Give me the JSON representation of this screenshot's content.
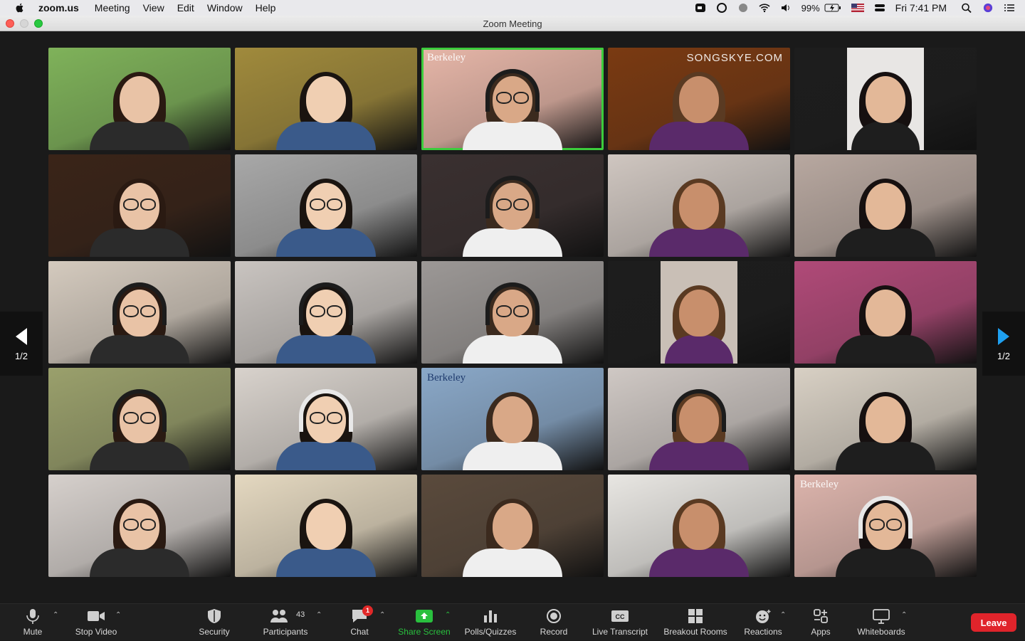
{
  "menubar": {
    "app": "zoom.us",
    "items": [
      "Meeting",
      "View",
      "Edit",
      "Window",
      "Help"
    ],
    "battery": "99%",
    "clock": "Fri 7:41 PM"
  },
  "window": {
    "title": "Zoom Meeting"
  },
  "gallery": {
    "page_left": "1/2",
    "page_right": "1/2",
    "tiles": [
      {
        "bg": "#7fb25a",
        "tag": ""
      },
      {
        "bg": "#a08a3c",
        "tag": ""
      },
      {
        "bg": "#e6b6a8",
        "tag": "Berkeley",
        "speaking": true
      },
      {
        "bg": "#7a3a12",
        "tag": "SONGSKYE.COM"
      },
      {
        "bg": "#1d1d1d",
        "tag": ""
      },
      {
        "bg": "#3a2418",
        "tag": ""
      },
      {
        "bg": "#a8a8a8",
        "tag": ""
      },
      {
        "bg": "#3a3030",
        "tag": ""
      },
      {
        "bg": "#cfc6c0",
        "tag": ""
      },
      {
        "bg": "#b8a8a0",
        "tag": ""
      },
      {
        "bg": "#d4cabe",
        "tag": ""
      },
      {
        "bg": "#c9c4c0",
        "tag": ""
      },
      {
        "bg": "#9c9896",
        "tag": ""
      },
      {
        "bg": "#1d1d1d",
        "tag": ""
      },
      {
        "bg": "#b04a78",
        "tag": ""
      },
      {
        "bg": "#9aa06c",
        "tag": ""
      },
      {
        "bg": "#d8d2cc",
        "tag": ""
      },
      {
        "bg": "#8aa8c8",
        "tag": "Berkeley",
        "dark": true
      },
      {
        "bg": "#cfc8c4",
        "tag": ""
      },
      {
        "bg": "#d8d0c4",
        "tag": ""
      },
      {
        "bg": "#d6d0cc",
        "tag": ""
      },
      {
        "bg": "#e4d8c0",
        "tag": ""
      },
      {
        "bg": "#5a4a3c",
        "tag": ""
      },
      {
        "bg": "#e8e6e2",
        "tag": ""
      },
      {
        "bg": "#dcb4ac",
        "tag": "Berkeley"
      }
    ]
  },
  "toolbar": {
    "mute": "Mute",
    "stop_video": "Stop Video",
    "security": "Security",
    "participants": "Participants",
    "participants_count": "43",
    "chat": "Chat",
    "chat_badge": "1",
    "share_screen": "Share Screen",
    "polls": "Polls/Quizzes",
    "record": "Record",
    "live_transcript": "Live Transcript",
    "breakout": "Breakout Rooms",
    "reactions": "Reactions",
    "apps": "Apps",
    "whiteboards": "Whiteboards",
    "leave": "Leave"
  },
  "colors": {
    "accent_green": "#29c03e",
    "leave_red": "#e0242b",
    "speaking_border": "#3ccc3c"
  }
}
